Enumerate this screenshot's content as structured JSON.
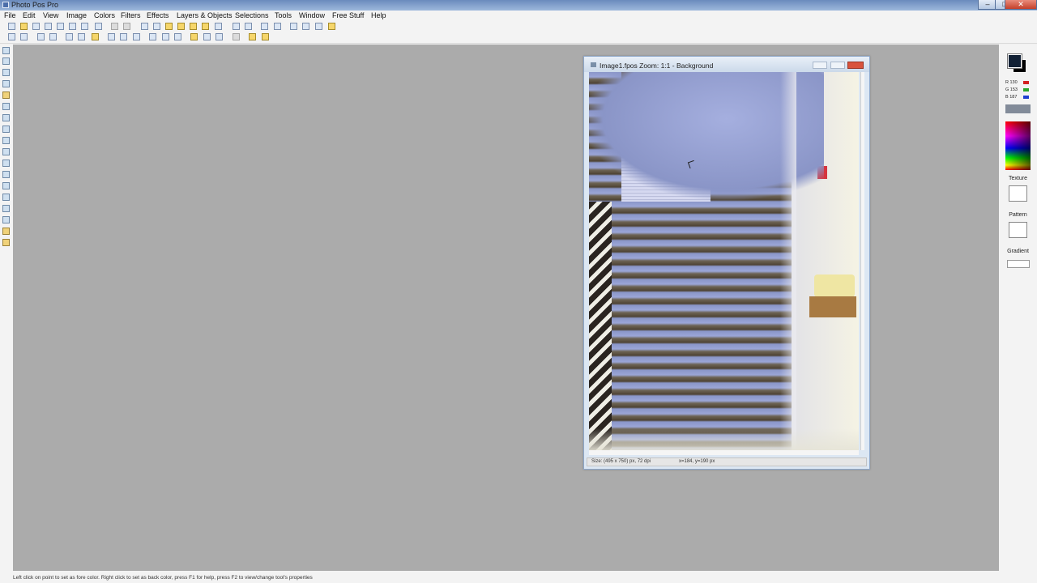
{
  "window": {
    "title": "Photo Pos Pro",
    "controls": [
      "–",
      "□",
      "✕"
    ]
  },
  "menubar": {
    "items": [
      "File",
      "Edit",
      "View",
      "Image",
      "Colors",
      "Filters",
      "Effects",
      "Layers & Objects",
      "Selections",
      "Tools",
      "Window",
      "Free Stuff",
      "Help"
    ]
  },
  "image_window": {
    "title": "Image1.fpos  Zoom: 1:1 - Background",
    "status_size": "Size: (495 x 750) px, 72 dpi",
    "status_coords": "x=184, y=190 px"
  },
  "right_panel": {
    "rgb": [
      {
        "label": "R 130",
        "color": "#d42020"
      },
      {
        "label": "G 153",
        "color": "#2aa62a"
      },
      {
        "label": "B 187",
        "color": "#1f3fd1"
      }
    ],
    "texture_label": "Texture",
    "pattern_label": "Pattern",
    "gradient_label": "Gradient"
  },
  "statusbar": {
    "text": "Left click on point to set as fore color. Right click to set as back color, press F1 for help, press F2 to view/change tool's properties"
  },
  "colors": {
    "workspace": "#ababab",
    "titlebar": "#6a8bbd"
  }
}
